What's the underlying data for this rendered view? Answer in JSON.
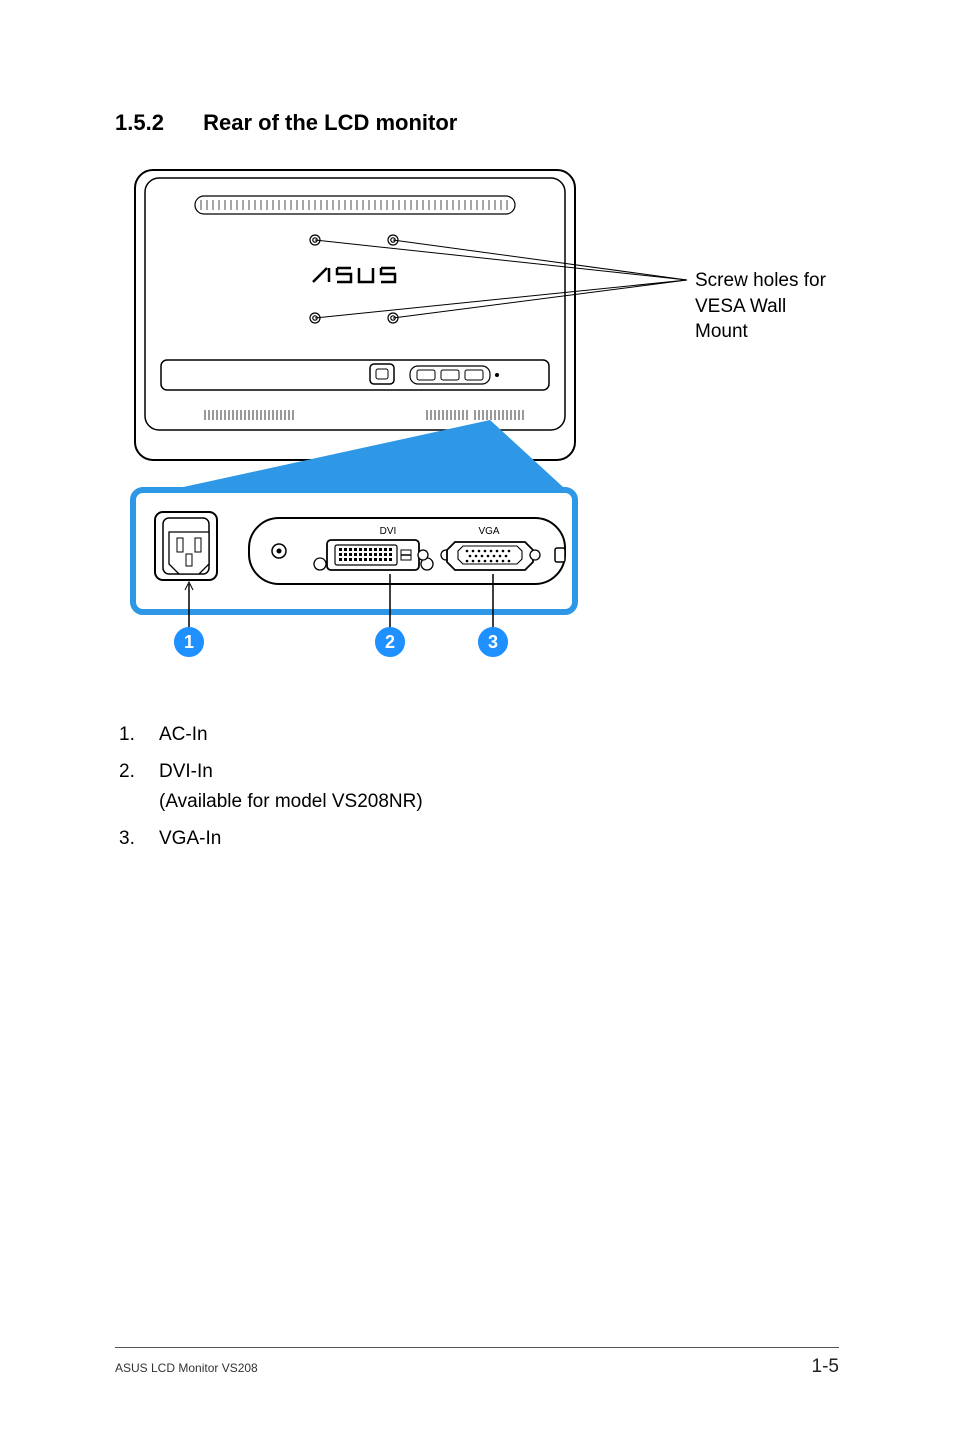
{
  "heading": {
    "number": "1.5.2",
    "title": "Rear of the LCD monitor"
  },
  "figure": {
    "callout": "Screw holes for VESA Wall Mount",
    "labels": {
      "dvi": "DVI",
      "vga": "VGA"
    },
    "badges": [
      "1",
      "2",
      "3"
    ]
  },
  "list": [
    {
      "n": "1.",
      "text": "AC-In"
    },
    {
      "n": "2.",
      "text": "DVI-In",
      "sub": "(Available for model VS208NR)"
    },
    {
      "n": "3.",
      "text": "VGA-In"
    }
  ],
  "footer": {
    "left": "ASUS LCD Monitor VS208",
    "right": "1-5"
  }
}
